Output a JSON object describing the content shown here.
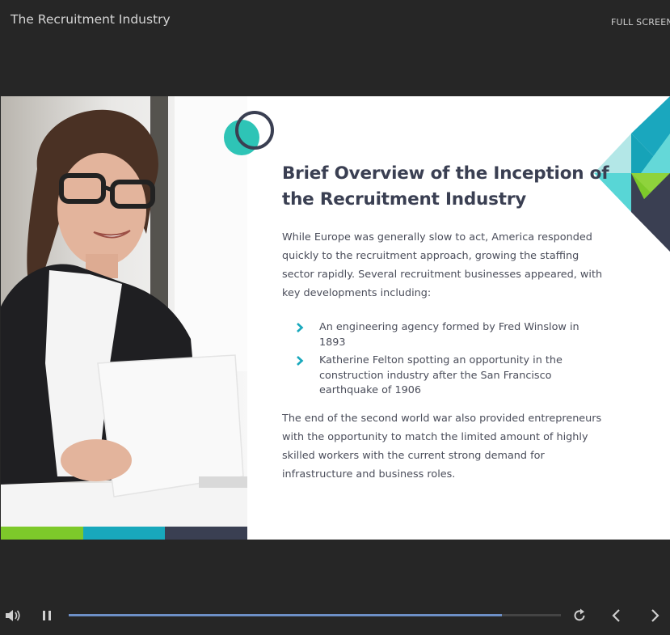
{
  "header": {
    "course_title": "The Recruitment Industry",
    "fullscreen_label": "FULL SCREEN"
  },
  "slide": {
    "heading": "Brief Overview of the Inception of the Recruitment Industry",
    "paragraph1": "While Europe was generally slow to act, America responded quickly to the recruitment approach, growing the staffing sector rapidly. Several recruitment businesses appeared, with key developments including:",
    "bullets": [
      "An engineering agency formed by Fred Winslow in 1893",
      "Katherine Felton spotting an opportunity in the construction industry after the San Francisco earthquake of 1906"
    ],
    "paragraph2": "The end of the second world war also provided entrepreneurs with the opportunity to match the limited amount of highly skilled workers with the current strong demand for infrastructure and business roles.",
    "photo": "woman-with-glasses-holding-papers",
    "icons": {
      "bullet": "chevron-right-icon",
      "decoration": "circles-icon"
    }
  },
  "player": {
    "progress": 0.88,
    "icons": [
      "volume-icon",
      "pause-icon",
      "replay-icon",
      "prev-icon",
      "next-icon"
    ]
  },
  "colors": {
    "page_bg": "#262626",
    "heading": "#3a3f52",
    "teal": "#2ec4b6",
    "dark_navy": "#3a3f52",
    "green": "#7dc92a",
    "cyan": "#18a8bc",
    "progress": "#6d8fc6"
  }
}
